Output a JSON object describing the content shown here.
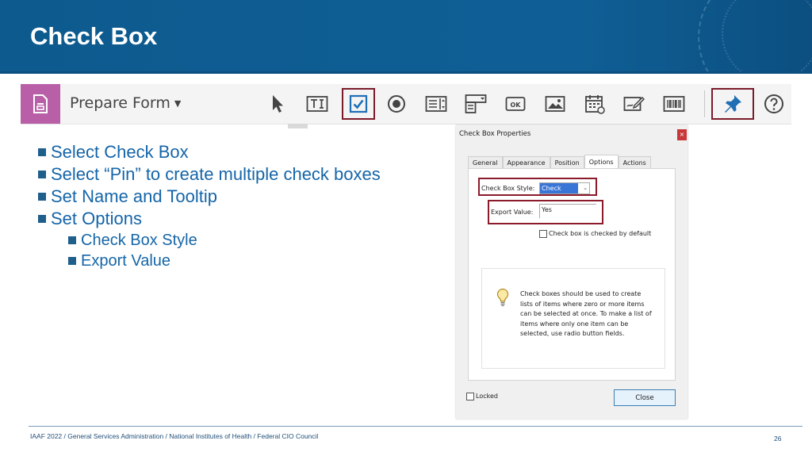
{
  "slide": {
    "title": "Check Box",
    "bullets": [
      "Select Check Box",
      "Select “Pin” to create multiple check boxes",
      "Set Name and Tooltip",
      "Set Options"
    ],
    "sub_bullets": [
      "Check Box Style",
      "Export Value"
    ]
  },
  "toolbar": {
    "label": "Prepare Form",
    "tools": [
      "select-cursor-icon",
      "text-field-icon",
      "check-box-icon",
      "radio-button-icon",
      "list-box-icon",
      "dropdown-icon",
      "button-ok-icon",
      "image-icon",
      "date-field-icon",
      "signature-icon",
      "barcode-icon",
      "pin-icon",
      "help-icon"
    ],
    "highlighted": [
      "check-box-icon",
      "pin-icon"
    ],
    "accent_color": "#b85fa7",
    "highlight_color": "#7b1b2a"
  },
  "dialog": {
    "title": "Check Box Properties",
    "close_glyph": "×",
    "tabs": [
      "General",
      "Appearance",
      "Position",
      "Options",
      "Actions"
    ],
    "active_tab": "Options",
    "style_label": "Check Box Style:",
    "style_value": "Check",
    "export_label": "Export Value:",
    "export_value": "Yes",
    "default_checked_label": "Check box is checked by default",
    "info_text": "Check boxes should be used to create lists of items where zero or more items can be selected at once. To make a list of items where only one item can be selected, use radio button fields.",
    "locked_label": "Locked",
    "close_button": "Close"
  },
  "footer": {
    "text": "IAAF 2022  /  General Services Administration  /  National Institutes of Health  /  Federal CIO Council",
    "page_number": "26"
  }
}
